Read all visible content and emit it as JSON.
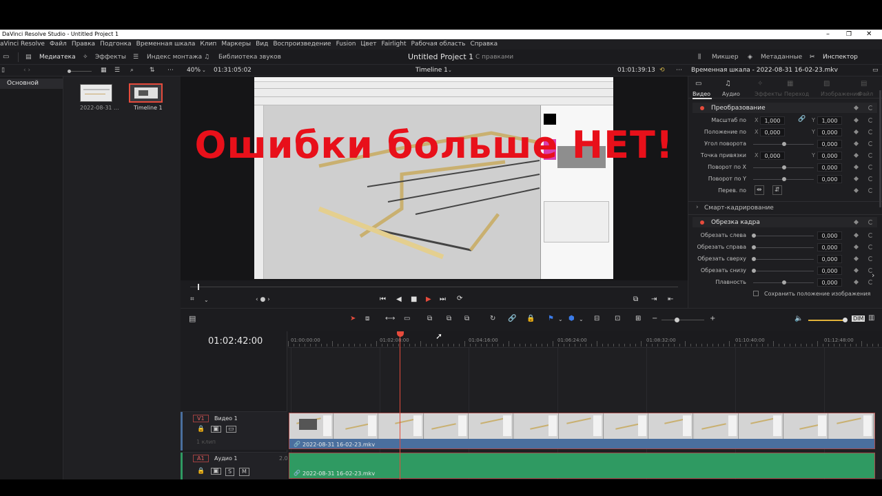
{
  "window": {
    "title": "DaVinci Resolve Studio - Untitled Project 1"
  },
  "menu": [
    "aVinci Resolve",
    "Файл",
    "Правка",
    "Подгонка",
    "Временная шкала",
    "Клип",
    "Маркеры",
    "Вид",
    "Воспроизведение",
    "Fusion",
    "Цвет",
    "Fairlight",
    "Рабочая область",
    "Справка"
  ],
  "toolbar": {
    "media": "Медиатека",
    "effects": "Эффекты",
    "edit_index": "Индекс монтажа",
    "sound_library": "Библиотека звуков",
    "project": "Untitled Project 1",
    "project_status": "С правками",
    "mixer": "Микшер",
    "metadata": "Метаданные",
    "inspector": "Инспектор"
  },
  "viewer_bar": {
    "zoom": "40%",
    "source_tc": "01:31:05:02",
    "timeline_name": "Timeline 1",
    "timeline_tc": "01:01:39:13"
  },
  "bins": {
    "root": "Основной"
  },
  "media": [
    {
      "name": "2022-08-31 ..."
    },
    {
      "name": "Timeline 1"
    }
  ],
  "overlay_text": "Ошибки больше НЕТ!",
  "inspector": {
    "clip_title": "Временная шкала - 2022-08-31 16-02-23.mkv",
    "tabs": [
      "Видео",
      "Аудио",
      "Эффекты",
      "Переход",
      "Изображение",
      "Файл"
    ],
    "transform": {
      "title": "Преобразование",
      "zoom": {
        "label": "Масштаб по",
        "x": "1,000",
        "y": "1,000"
      },
      "position": {
        "label": "Положение по",
        "x": "0,000",
        "y": "0,000"
      },
      "rotation": {
        "label": "Угол поворота",
        "v": "0,000"
      },
      "anchor": {
        "label": "Точка привязки",
        "x": "0,000",
        "y": "0,000"
      },
      "pitch": {
        "label": "Поворот по X",
        "v": "0,000"
      },
      "yaw": {
        "label": "Поворот по Y",
        "v": "0,000"
      },
      "flip": {
        "label": "Перев. по"
      }
    },
    "smart_reframe": "Смарт-кадрирование",
    "crop": {
      "title": "Обрезка кадра",
      "left": {
        "label": "Обрезать слева",
        "v": "0,000"
      },
      "right": {
        "label": "Обрезать справа",
        "v": "0,000"
      },
      "top": {
        "label": "Обрезать сверху",
        "v": "0,000"
      },
      "bottom": {
        "label": "Обрезать снизу",
        "v": "0,000"
      },
      "soft": {
        "label": "Плавность",
        "v": "0,000"
      },
      "retain": "Сохранить положение изображения"
    },
    "axis": {
      "x": "X",
      "y": "Y"
    }
  },
  "timeline": {
    "timecode": "01:02:42:00",
    "ruler": [
      "01:00:00:00",
      "01:02:08:00",
      "01:04:16:00",
      "01:06:24:00",
      "01:08:32:00",
      "01:10:40:00",
      "01:12:48:00"
    ],
    "tracks": {
      "v1": {
        "id": "V1",
        "name": "Видео 1",
        "clips": "1 клип",
        "clip_name": "2022-08-31 16-02-23.mkv"
      },
      "a1": {
        "id": "A1",
        "name": "Аудио 1",
        "level": "2.0",
        "clip_name": "2022-08-31 16-02-23.mkv",
        "s": "S",
        "m": "M"
      }
    }
  },
  "dim": "DIM",
  "colors": {
    "accent": "#e64b3c",
    "video_clip": "#4a6f9e",
    "audio_clip": "#2f9a62",
    "overlay_text": "#e8101a"
  }
}
